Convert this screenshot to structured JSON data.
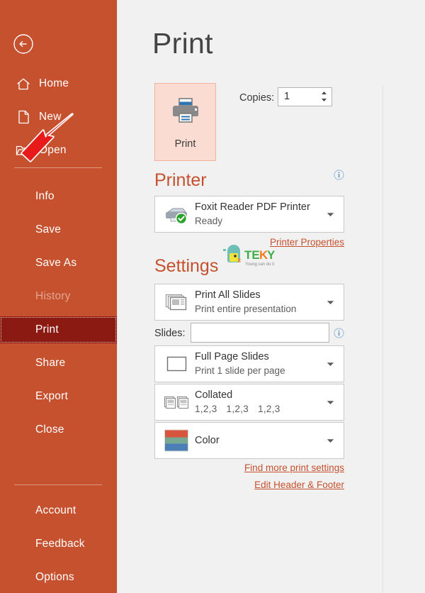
{
  "sidebar": {
    "back_label": "back-arrow",
    "top_items": [
      {
        "label": "Home",
        "icon": "home-icon"
      },
      {
        "label": "New",
        "icon": "new-document-icon"
      },
      {
        "label": "Open",
        "icon": "open-folder-icon"
      }
    ],
    "middle_items": [
      {
        "label": "Info",
        "state": "normal"
      },
      {
        "label": "Save",
        "state": "normal"
      },
      {
        "label": "Save As",
        "state": "normal"
      },
      {
        "label": "History",
        "state": "disabled"
      },
      {
        "label": "Print",
        "state": "selected"
      },
      {
        "label": "Share",
        "state": "normal"
      },
      {
        "label": "Export",
        "state": "normal"
      },
      {
        "label": "Close",
        "state": "normal"
      }
    ],
    "bottom_items": [
      {
        "label": "Account"
      },
      {
        "label": "Feedback"
      },
      {
        "label": "Options"
      }
    ],
    "accent_bg": "#c5512f",
    "selected_bg": "#8a1a12"
  },
  "main": {
    "title": "Print",
    "print_button": {
      "label": "Print",
      "icon": "printer-icon",
      "bg": "#fadcd2",
      "border": "#f0b49e"
    },
    "copies": {
      "label": "Copies:",
      "value": "1"
    },
    "printer_section": {
      "heading": "Printer",
      "info_icon": "info-icon",
      "selected": {
        "name": "Foxit Reader PDF Printer",
        "status": "Ready",
        "icon": "printer-status-ready-icon"
      },
      "properties_link": "Printer Properties"
    },
    "settings_section": {
      "heading": "Settings",
      "range": {
        "title": "Print All Slides",
        "subtitle": "Print entire presentation",
        "icon": "slides-stack-icon"
      },
      "slides": {
        "label": "Slides:",
        "value": "",
        "placeholder": "",
        "info_icon": "info-icon"
      },
      "layout": {
        "title": "Full Page Slides",
        "subtitle": "Print 1 slide per page",
        "icon": "full-page-icon"
      },
      "collation": {
        "title": "Collated",
        "sequences": [
          "1,2,3",
          "1,2,3",
          "1,2,3"
        ],
        "icon": "collate-icon"
      },
      "color": {
        "title": "Color",
        "icon": "color-swatch-icon",
        "swatch_colors": [
          "#d8553d",
          "#77a893",
          "#4a7eb5"
        ]
      },
      "links": [
        "Find more print settings",
        "Edit Header & Footer"
      ]
    },
    "accent": "#c5512f"
  },
  "watermark": {
    "brand": "TEKY",
    "tagline": "Young can do it",
    "mascot": "chick-logo"
  },
  "annotation": {
    "arrow": "red-arrow-pointing-to-print-button",
    "color": "#e81a1a"
  }
}
